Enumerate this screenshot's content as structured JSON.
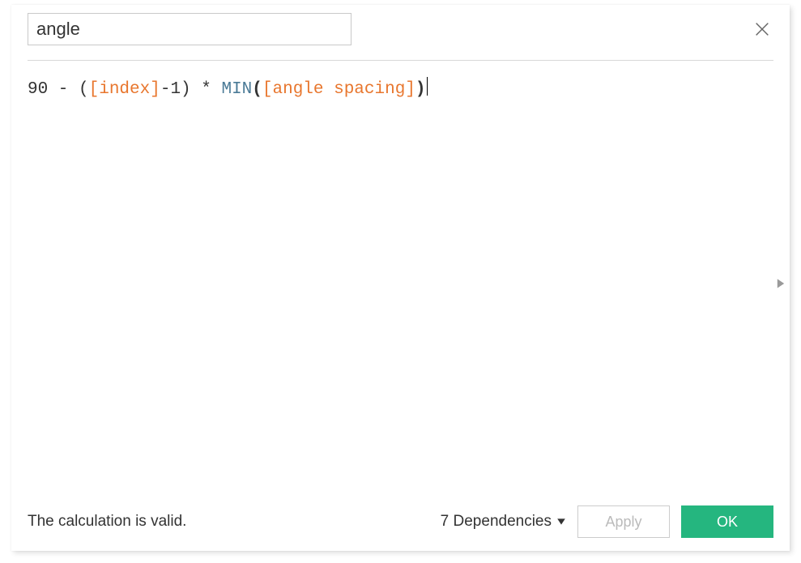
{
  "dialog": {
    "name_value": "angle",
    "formula": {
      "tokens": [
        {
          "kind": "op",
          "text": "90 - ("
        },
        {
          "kind": "field",
          "text": "[index]"
        },
        {
          "kind": "op",
          "text": "-1) * "
        },
        {
          "kind": "func",
          "text": "MIN"
        },
        {
          "kind": "paren",
          "text": "("
        },
        {
          "kind": "field",
          "text": "[angle spacing]"
        },
        {
          "kind": "paren",
          "text": ")"
        }
      ]
    },
    "status_text": "The calculation is valid.",
    "dependencies_label": "7 Dependencies",
    "apply_label": "Apply",
    "ok_label": "OK"
  }
}
